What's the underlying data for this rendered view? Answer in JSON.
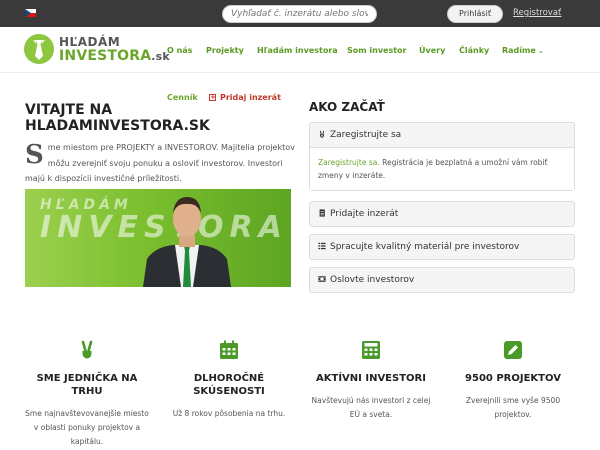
{
  "topbar": {
    "search_placeholder": "Vyhľadať č. inzerátu alebo slovné spojenie",
    "login_label": "Prihlásiť",
    "register_label": "Registrovať"
  },
  "logo": {
    "line1": "HĽADÁM",
    "line2": "INVESTORA",
    "tld": ".sk"
  },
  "nav": {
    "items": [
      "O nás",
      "Projekty",
      "Hľadám investora",
      "Som investor",
      "Úvery",
      "Články",
      "Radíme"
    ]
  },
  "sublinks": {
    "cennik": "Cenník",
    "pridaj": "Pridaj inzerát"
  },
  "welcome": {
    "title": "VITAJTE NA HLADAMINVESTORA.SK",
    "dropcap": "S",
    "text": "me miestom pre PROJEKTY a INVESTOROV. Majitelia projektov môžu zverejniť svoju ponuku a osloviť investorov. Investori majú k dispozícii investičné príležitosti."
  },
  "banner": {
    "line1": "HĽADÁM",
    "line2": "INVESTORA"
  },
  "how": {
    "title": "AKO ZAČAŤ",
    "items": [
      {
        "label": "Zaregistrujte sa",
        "icon": "victory-hand-icon"
      },
      {
        "label": "Pridajte inzerát",
        "icon": "document-icon"
      },
      {
        "label": "Spracujte kvalitný materiál pre investorov",
        "icon": "list-icon"
      },
      {
        "label": "Oslovte investorov",
        "icon": "film-icon"
      }
    ],
    "body_link": "Zaregistrujte sa.",
    "body_text": " Registrácia je bezplatná a umožní vám robiť zmeny v inzeráte."
  },
  "features": [
    {
      "icon": "victory-hand-icon",
      "title": "SME JEDNIČKA NA TRHU",
      "text": "Sme najnavštevovanejšie miesto v oblasti ponuky projektov a kapitálu."
    },
    {
      "icon": "calendar-icon",
      "title": "DLHOROČNÉ SKÚSENOSTI",
      "text": "Už 8 rokov pôsobenia na trhu."
    },
    {
      "icon": "calculator-icon",
      "title": "AKTÍVNI INVESTORI",
      "text": "Navštevujú nás investori z celej EÚ a sveta."
    },
    {
      "icon": "pencil-icon",
      "title": "9500 PROJEKTOV",
      "text": "Zverejnili sme vyše 9500 projektov."
    }
  ],
  "colors": {
    "accent": "#6aa52b",
    "topbar": "#3a3a3a",
    "red": "#c0392b"
  }
}
